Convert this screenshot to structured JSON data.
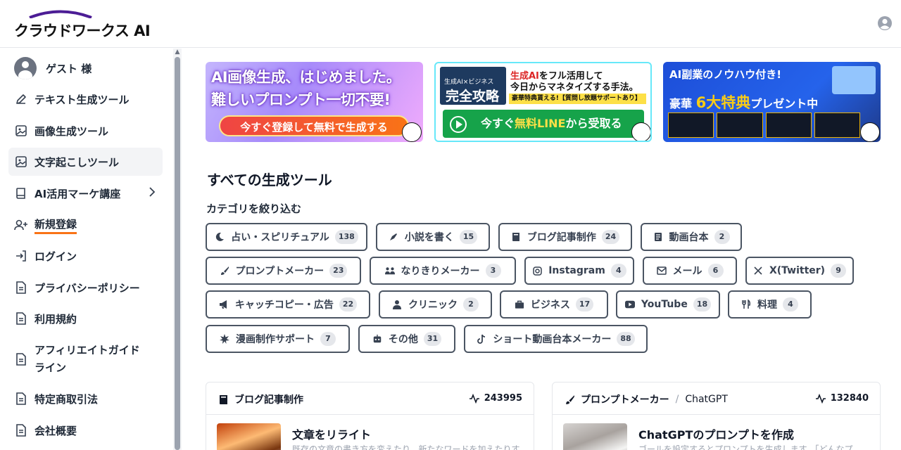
{
  "header": {
    "logo_text": "クラウドワークス AI",
    "user_icon": "user-circle-icon"
  },
  "sidebar": {
    "guest_label": "ゲスト 様",
    "items": [
      {
        "label": "テキスト生成ツール",
        "icon": "pencil-icon"
      },
      {
        "label": "画像生成ツール",
        "icon": "image-icon"
      },
      {
        "label": "文字起こしツール",
        "icon": "image-icon",
        "active": true
      },
      {
        "label": "AI活用マーケ講座",
        "icon": "book-icon",
        "has_submenu": true
      },
      {
        "label": "新規登録",
        "icon": "user-plus-icon",
        "accent_underline": "#f97316"
      },
      {
        "label": "ログイン",
        "icon": "login-icon"
      },
      {
        "label": "プライバシーポリシー",
        "icon": "document-icon"
      },
      {
        "label": "利用規約",
        "icon": "document-icon"
      },
      {
        "label": "アフィリエイトガイドライン",
        "line1": "アフィリエイトガイド",
        "line2": "ライン",
        "icon": "document-icon"
      },
      {
        "label": "特定商取引法",
        "icon": "document-icon"
      },
      {
        "label": "会社概要",
        "icon": "document-icon"
      }
    ]
  },
  "banners": [
    {
      "line1": "AI画像生成、はじめました。",
      "line2": "難しいプロンプト一切不要!",
      "cta": "今すぐ登録して無料で生成する"
    },
    {
      "badge_small": "生成AI×ビジネス",
      "badge_big": "完全攻略",
      "head_red": "生成AI",
      "head1_rest": "をフル活用して",
      "head2": "今日からマネタイズする手法。",
      "strip": "豪華特典貰える!【質問し放題サポートあり】",
      "cta_pre": "今すぐ",
      "cta_highlight": "無料LINE",
      "cta_post": "から受取る"
    },
    {
      "line1": "AI副業のノウハウ付き!",
      "line2_pre": "豪華",
      "line2_highlight": "6大特典",
      "line2_post": "プレゼント中"
    }
  ],
  "main": {
    "section_title": "すべての生成ツール",
    "filter_title": "カテゴリを絞り込む"
  },
  "categories": [
    {
      "label": "占い・スピリチュアル",
      "count": "138",
      "icon": "moon-icon"
    },
    {
      "label": "小説を書く",
      "count": "15",
      "icon": "feather-pen-icon"
    },
    {
      "label": "ブログ記事制作",
      "count": "24",
      "icon": "book-icon"
    },
    {
      "label": "動画台本",
      "count": "2",
      "icon": "script-icon"
    },
    {
      "label": "プロンプトメーカー",
      "count": "23",
      "icon": "brush-icon"
    },
    {
      "label": "なりきりメーカー",
      "count": "3",
      "icon": "people-icon"
    },
    {
      "label": "Instagram",
      "count": "4",
      "icon": "instagram-icon"
    },
    {
      "label": "メール",
      "count": "6",
      "icon": "envelope-icon"
    },
    {
      "label": "X(Twitter)",
      "count": "9",
      "icon": "x-logo-icon"
    },
    {
      "label": "キャッチコピー・広告",
      "count": "22",
      "icon": "megaphone-icon"
    },
    {
      "label": "クリニック",
      "count": "2",
      "icon": "doctor-icon"
    },
    {
      "label": "ビジネス",
      "count": "17",
      "icon": "briefcase-icon"
    },
    {
      "label": "YouTube",
      "count": "18",
      "icon": "youtube-icon"
    },
    {
      "label": "料理",
      "count": "4",
      "icon": "utensils-icon"
    },
    {
      "label": "漫画制作サポート",
      "count": "7",
      "icon": "burst-icon"
    },
    {
      "label": "その他",
      "count": "31",
      "icon": "robot-icon"
    },
    {
      "label": "ショート動画台本メーカー",
      "count": "88",
      "icon": "tiktok-icon"
    }
  ],
  "cards": [
    {
      "category": "ブログ記事制作",
      "sub": "",
      "count": "243995",
      "title": "文章をリライト",
      "desc": "既存の文章の書き方を変えたり、新たなワードを加えたりす",
      "icon": "book-icon"
    },
    {
      "category": "プロンプトメーカー",
      "sub": "ChatGPT",
      "count": "132840",
      "title": "ChatGPTのプロンプトを作成",
      "desc": "ゴールを設定するとプロンプトを生成します。「どんなプ",
      "icon": "brush-icon"
    }
  ],
  "colors": {
    "accent_orange": "#f97316",
    "line_green": "#16a34a",
    "banner_blue": "#2563eb"
  }
}
